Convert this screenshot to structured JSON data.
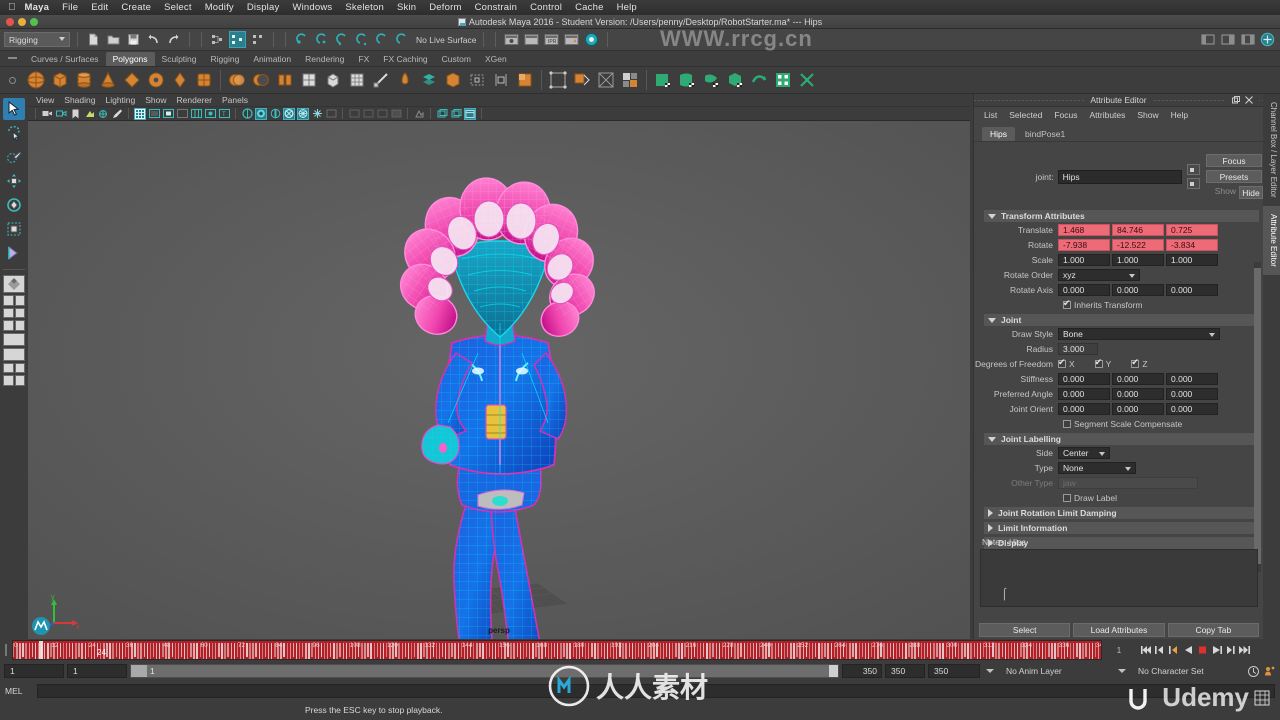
{
  "os_menu": {
    "apple": "◉",
    "items": [
      "Maya",
      "File",
      "Edit",
      "Create",
      "Select",
      "Modify",
      "Display",
      "Windows",
      "Skeleton",
      "Skin",
      "Deform",
      "Constrain",
      "Control",
      "Cache",
      "Help"
    ]
  },
  "titlebar": {
    "title": "Autodesk Maya 2016 - Student Version: /Users/penny/Desktop/RobotStarter.ma*   ---   Hips"
  },
  "statusline": {
    "menuset": "Rigging",
    "live_surface": "No Live Surface"
  },
  "shelf": {
    "tabs": [
      "Curves / Surfaces",
      "Polygons",
      "Sculpting",
      "Rigging",
      "Animation",
      "Rendering",
      "FX",
      "FX Caching",
      "Custom",
      "XGen"
    ],
    "active_tab": "Polygons"
  },
  "viewport": {
    "menu": [
      "View",
      "Shading",
      "Lighting",
      "Show",
      "Renderer",
      "Panels"
    ],
    "camera_label": "persp"
  },
  "attribute_editor": {
    "title": "Attribute Editor",
    "menu": [
      "List",
      "Selected",
      "Focus",
      "Attributes",
      "Show",
      "Help"
    ],
    "tabs": [
      "Hips",
      "bindPose1"
    ],
    "active_tab": "Hips",
    "joint_label": "joint:",
    "joint_name": "Hips",
    "focus_button": "Focus",
    "presets_button": "Presets",
    "show_label": "Show",
    "hide_button": "Hide",
    "sections": {
      "transform_attributes": "Transform Attributes",
      "joint": "Joint",
      "joint_labelling": "Joint Labelling",
      "joint_rotation_limit_damping": "Joint Rotation Limit Damping",
      "limit_information": "Limit Information",
      "display": "Display"
    },
    "transform": {
      "translate_label": "Translate",
      "translate": [
        "1.468",
        "84.746",
        "0.725"
      ],
      "rotate_label": "Rotate",
      "rotate": [
        "-7.938",
        "-12.522",
        "-3.834"
      ],
      "scale_label": "Scale",
      "scale": [
        "1.000",
        "1.000",
        "1.000"
      ],
      "rotate_order_label": "Rotate Order",
      "rotate_order": "xyz",
      "rotate_axis_label": "Rotate Axis",
      "rotate_axis": [
        "0.000",
        "0.000",
        "0.000"
      ],
      "inherits_transform": "Inherits Transform"
    },
    "joint_attrs": {
      "draw_style_label": "Draw Style",
      "draw_style": "Bone",
      "radius_label": "Radius",
      "radius": "3.000",
      "dof_label": "Degrees of Freedom",
      "dof": [
        "X",
        "Y",
        "Z"
      ],
      "stiffness_label": "Stiffness",
      "stiffness": [
        "0.000",
        "0.000",
        "0.000"
      ],
      "preferred_angle_label": "Preferred Angle",
      "preferred_angle": [
        "0.000",
        "0.000",
        "0.000"
      ],
      "joint_orient_label": "Joint Orient",
      "joint_orient": [
        "0.000",
        "0.000",
        "0.000"
      ],
      "segment_scale_compensate": "Segment Scale Compensate"
    },
    "labelling": {
      "side_label": "Side",
      "side": "Center",
      "type_label": "Type",
      "type": "None",
      "other_type_label": "Other Type",
      "other_type_placeholder": "jaw",
      "draw_label": "Draw Label"
    },
    "notes_label": "Notes:",
    "notes_target": "Hips",
    "footer": [
      "Select",
      "Load Attributes",
      "Copy Tab"
    ]
  },
  "right_tabs": [
    "Channel Box / Layer Editor",
    "Attribute Editor"
  ],
  "timeline": {
    "current_frame": "1",
    "current_frame_marker": "24",
    "ticks": [
      "0",
      "12",
      "24",
      "36",
      "48",
      "60",
      "72",
      "84",
      "96",
      "108",
      "120",
      "132",
      "144",
      "156",
      "168",
      "180",
      "192",
      "204",
      "216",
      "228",
      "240",
      "252",
      "264",
      "276",
      "288",
      "300",
      "312",
      "324",
      "336",
      "348"
    ],
    "end_display": "1"
  },
  "range": {
    "start": "1",
    "playback_start": "1",
    "range_label": "1",
    "playback_end": "350",
    "end": "350",
    "max": "350",
    "anim_layer": "No Anim Layer",
    "character_set": "No Character Set"
  },
  "command": {
    "language": "MEL",
    "value": ""
  },
  "help": {
    "message": "Press the ESC key to stop playback."
  },
  "watermarks": {
    "top": "WWW.rrcg.cn",
    "brand": "Udemy"
  },
  "colors": {
    "accent_red": "#ed6a77",
    "timeline_red": "#b21f26",
    "teal": "#2a7f8c",
    "selection_blue": "#2f7fb0",
    "shelf_orange": "#d07a2c"
  }
}
